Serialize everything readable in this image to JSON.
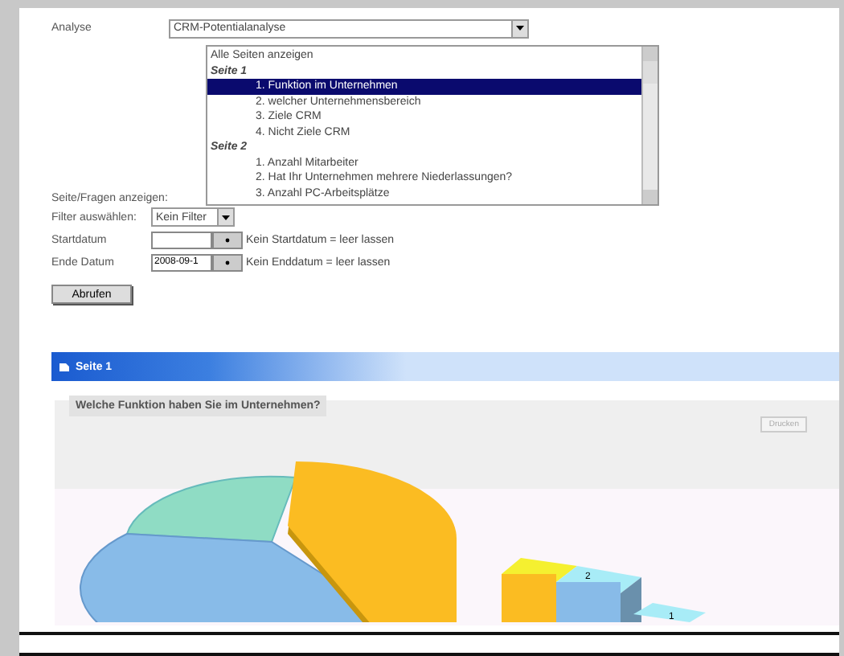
{
  "analysis": {
    "label": "Analyse",
    "value": "CRM-Potentialanalyse"
  },
  "pages_list": {
    "label": "Seite/Fragen anzeigen:",
    "items": [
      {
        "kind": "all",
        "text": "Alle Seiten anzeigen",
        "selected": false
      },
      {
        "kind": "page",
        "text": "Seite 1",
        "selected": false
      },
      {
        "kind": "question",
        "text": "1. Funktion im Unternehmen",
        "selected": true
      },
      {
        "kind": "question",
        "text": "2. welcher Unternehmensbereich",
        "selected": false
      },
      {
        "kind": "question",
        "text": "3. Ziele CRM",
        "selected": false
      },
      {
        "kind": "question",
        "text": "4. Nicht Ziele CRM",
        "selected": false
      },
      {
        "kind": "page",
        "text": "Seite 2",
        "selected": false
      },
      {
        "kind": "question",
        "text": "1. Anzahl Mitarbeiter",
        "selected": false
      },
      {
        "kind": "question",
        "text": "2. Hat Ihr Unternehmen mehrere Niederlassungen?",
        "selected": false
      },
      {
        "kind": "question",
        "text": "3. Anzahl PC-Arbeitsplätze",
        "selected": false
      }
    ]
  },
  "filter": {
    "label": "Filter auswählen:",
    "value": "Kein Filter"
  },
  "dates": [
    {
      "label": "Startdatum",
      "hint": "Kein Startdatum = leer lassen"
    },
    {
      "label": "Ende Datum",
      "value": "2008-09-1",
      "hint": "Kein Enddatum = leer lassen"
    }
  ],
  "submit": "Abrufen",
  "section": {
    "title": "Seite 1"
  },
  "chart": {
    "title": "Welche Funktion haben Sie im Unternehmen?",
    "button": "Drucken",
    "bar_labels": [
      "2",
      "1"
    ]
  }
}
